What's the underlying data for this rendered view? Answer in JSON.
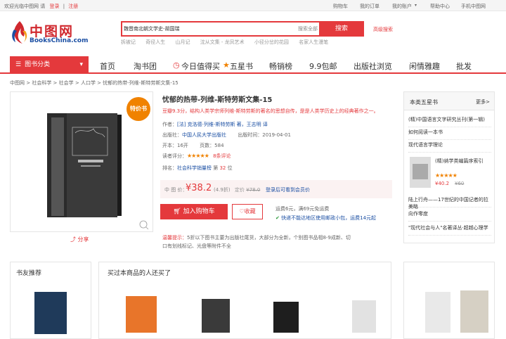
{
  "topbar": {
    "welcome": "欢迎光临中图网 请",
    "login": "登录",
    "sep": "|",
    "register": "注册",
    "links": [
      "购物车",
      "我的订单",
      "我的账户",
      "帮助中心",
      "手机中图网"
    ]
  },
  "logo": {
    "cn": "中图网",
    "en": "BooksChina.com"
  },
  "search": {
    "value": "魏晋南北朝文学史-胡国瑞",
    "scope": "搜索全部",
    "button": "搜索",
    "advanced": "高级搜索",
    "hotwords": [
      "拆被记",
      "奇径人生",
      "山月记",
      "沈从文集 - 龙凤艺术",
      "小径分岔的花园",
      "名家人生漫笔"
    ]
  },
  "nav": {
    "category": "图书分类",
    "items": [
      "首页",
      "淘书团",
      "今日值得买",
      "五星书",
      "畅销榜",
      "9.9包邮",
      "出版社浏览",
      "闲情雅趣",
      "批发"
    ]
  },
  "breadcrumb": "中图网 > 社会科学 > 社会学 > 人口学 > 忧郁的热带-列维-斯特劳斯文集-15",
  "product": {
    "tag": "特价书",
    "share": "分享",
    "title": "忧郁的热带-列维-斯特劳斯文集-15",
    "promo": "豆瓣9.3分，结构人类学宗师列维-斯特劳斯的著名的思想自传，是是人类学历史上的经典著作之一。",
    "author_label": "作者：",
    "author": "[法] 克洛德·列维-斯特劳斯 著，王志明 译",
    "publisher_label": "出版社：",
    "publisher": "中国人民大学出版社",
    "pubdate_label": "出版时间：",
    "pubdate": "2019-04-01",
    "format_label": "开本：",
    "format": "16开",
    "pages_label": "页数：",
    "pages": "584",
    "rating_label": "读者评分：",
    "rating_stars": "★★★★★",
    "rating_link": "8条评论",
    "rank_label": "排名：",
    "rank_list": "社会科学销量榜",
    "rank_prefix": "第",
    "rank_value": "32",
    "rank_suffix": "位",
    "price_label": "中 图 价：",
    "price": "¥38.2",
    "discount": "(4.9折)",
    "orig_label": "定价",
    "orig_price": "¥78.0",
    "member_login": "登录后可看到会员价",
    "cart_button": "加入购物车",
    "fav_button": "收藏",
    "shipping": "运费6元，满69元免运费",
    "express": "快递不能达地区使用邮政小包，运费14元起",
    "tips_label": "温馨提示：",
    "tips": "5折以下图书主要为出版社尾货，大部分为全新，个别图书品相8-9成新、切口有划线标记、光盘等附件不全"
  },
  "sidebar": {
    "title": "本类五星书",
    "more": "更多>",
    "items": [
      "(精)中国语言文字研究丛刊(第一辑)",
      "如何阅读一本书",
      "现代语言学理论",
      "(精)纳学类编篇序索引",
      "陆上行舟——17世纪的中国记者的拉美略",
      "向作零度",
      "\"现代社会与人\"名著译丛·超越心理学"
    ],
    "feature_title": "(精)纳学类编篇序索引",
    "feature_stars": "★★★★★",
    "feature_price": "¥40.2",
    "feature_orig": "¥60"
  },
  "bottom": {
    "friends_title": "书友推荐",
    "also_bought_title": "买过本商品的人还买了"
  }
}
